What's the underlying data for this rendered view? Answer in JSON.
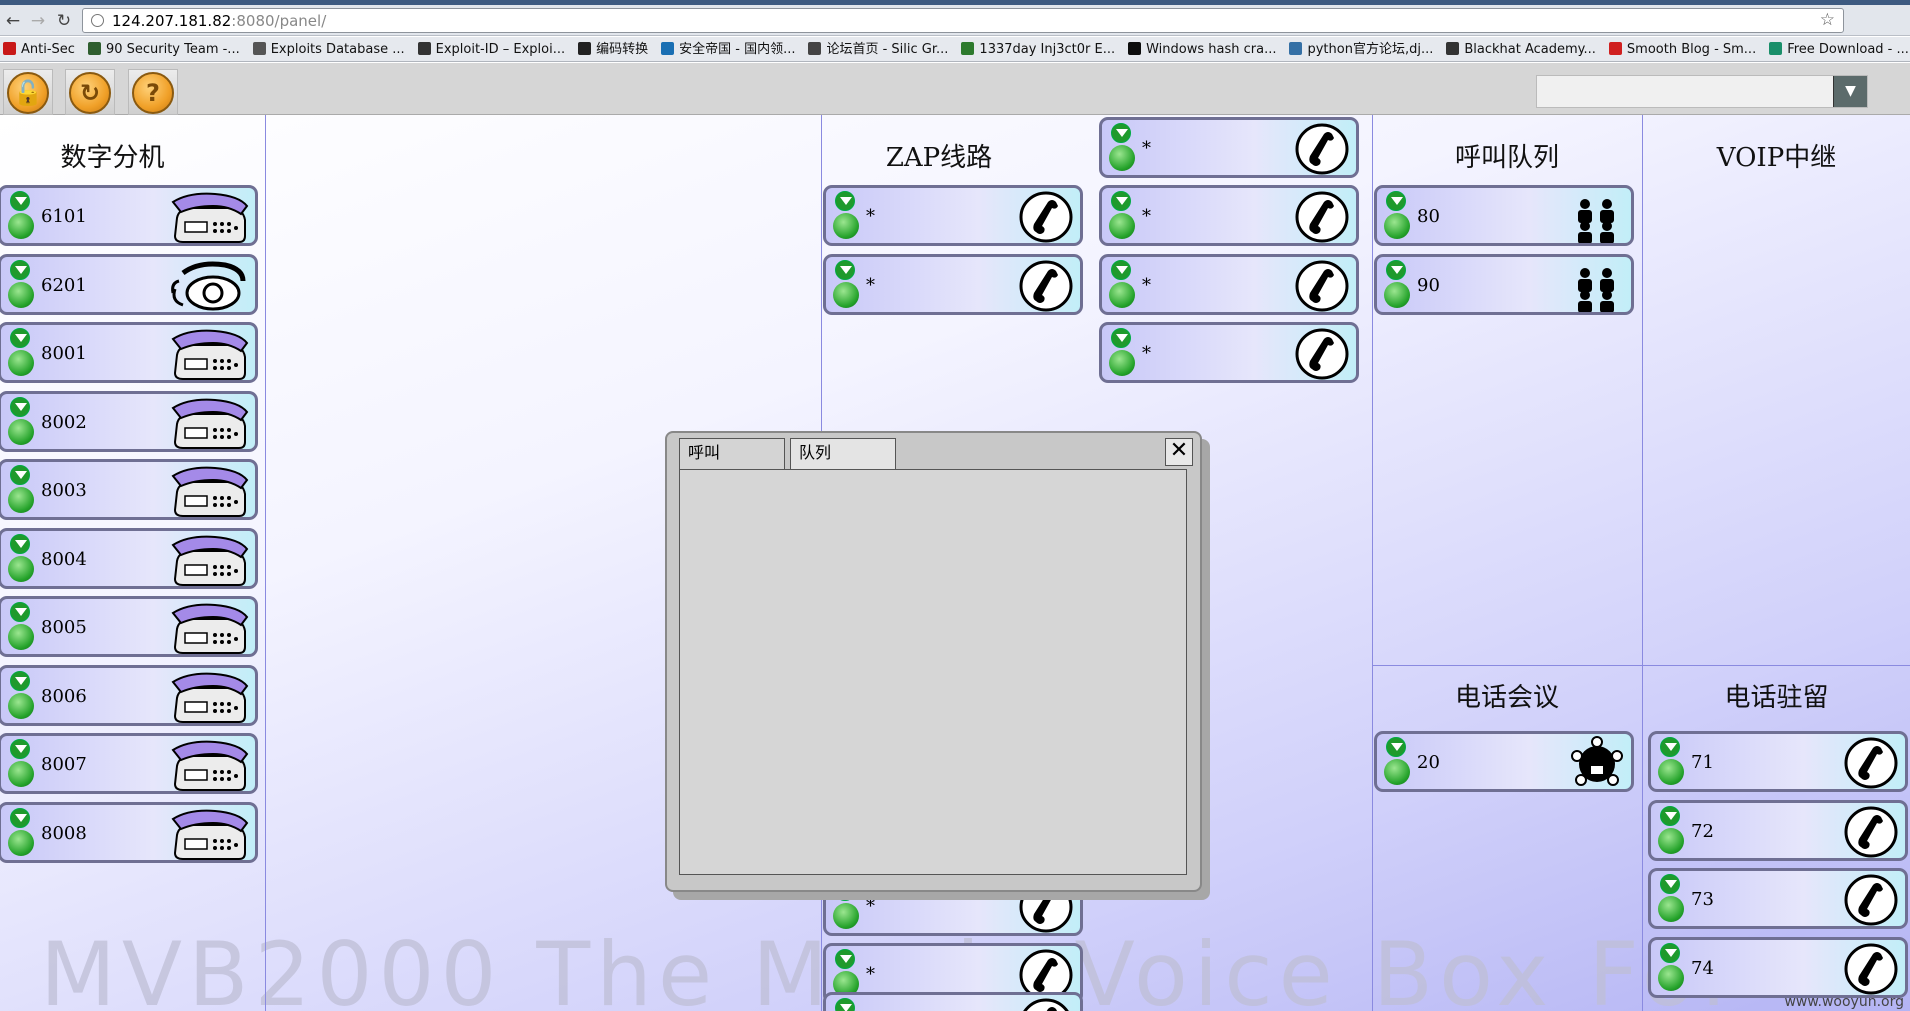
{
  "browser": {
    "url_host": "124.207.181.82",
    "url_rest": ":8080/panel/",
    "bookmarks": [
      {
        "label": "Anti-Sec",
        "color": "#c81818"
      },
      {
        "label": "90 Security Team -...",
        "color": "#2f5e2f"
      },
      {
        "label": "Exploits Database ...",
        "color": "#555555"
      },
      {
        "label": "Exploit-ID – Exploi...",
        "color": "#333333"
      },
      {
        "label": "编码转换",
        "color": "#222222"
      },
      {
        "label": "安全帝国 - 国内领...",
        "color": "#1a6fb3"
      },
      {
        "label": "论坛首页 - Silic Gr...",
        "color": "#444444"
      },
      {
        "label": "1337day Inj3ct0r E...",
        "color": "#2d7a2d"
      },
      {
        "label": "Windows hash cra...",
        "color": "#0d0d0d"
      },
      {
        "label": "python官方论坛,dj...",
        "color": "#3570a5"
      },
      {
        "label": "Blackhat Academy...",
        "color": "#333333"
      },
      {
        "label": "Smooth Blog - Sm...",
        "color": "#d02020"
      },
      {
        "label": "Free Download - ...",
        "color": "#1a8f6a"
      }
    ]
  },
  "toolbar": {
    "lock_icon": "lock-icon",
    "refresh_icon": "refresh-icon",
    "help_icon": "help-icon",
    "select_value": ""
  },
  "sections": {
    "extensions": "数字分机",
    "zap": "ZAP线路",
    "queues": "呼叫队列",
    "voip": "VOIP中继",
    "conference": "电话会议",
    "parking": "电话驻留"
  },
  "extensions": [
    "6101",
    "6201",
    "8001",
    "8002",
    "8003",
    "8004",
    "8005",
    "8006",
    "8007",
    "8008"
  ],
  "zap_lines": [
    "*",
    "*",
    "*",
    "*",
    "*",
    "*",
    "*",
    "*",
    "*",
    "*"
  ],
  "queues": [
    "80",
    "90"
  ],
  "conference": [
    "20"
  ],
  "parking": [
    "71",
    "72",
    "73",
    "74"
  ],
  "dialog": {
    "tab_call": "呼叫",
    "tab_queue": "队列",
    "close": "✕"
  },
  "watermark": "MVB2000 The Magic Voice Box For",
  "credit": "www.wooyun.org"
}
